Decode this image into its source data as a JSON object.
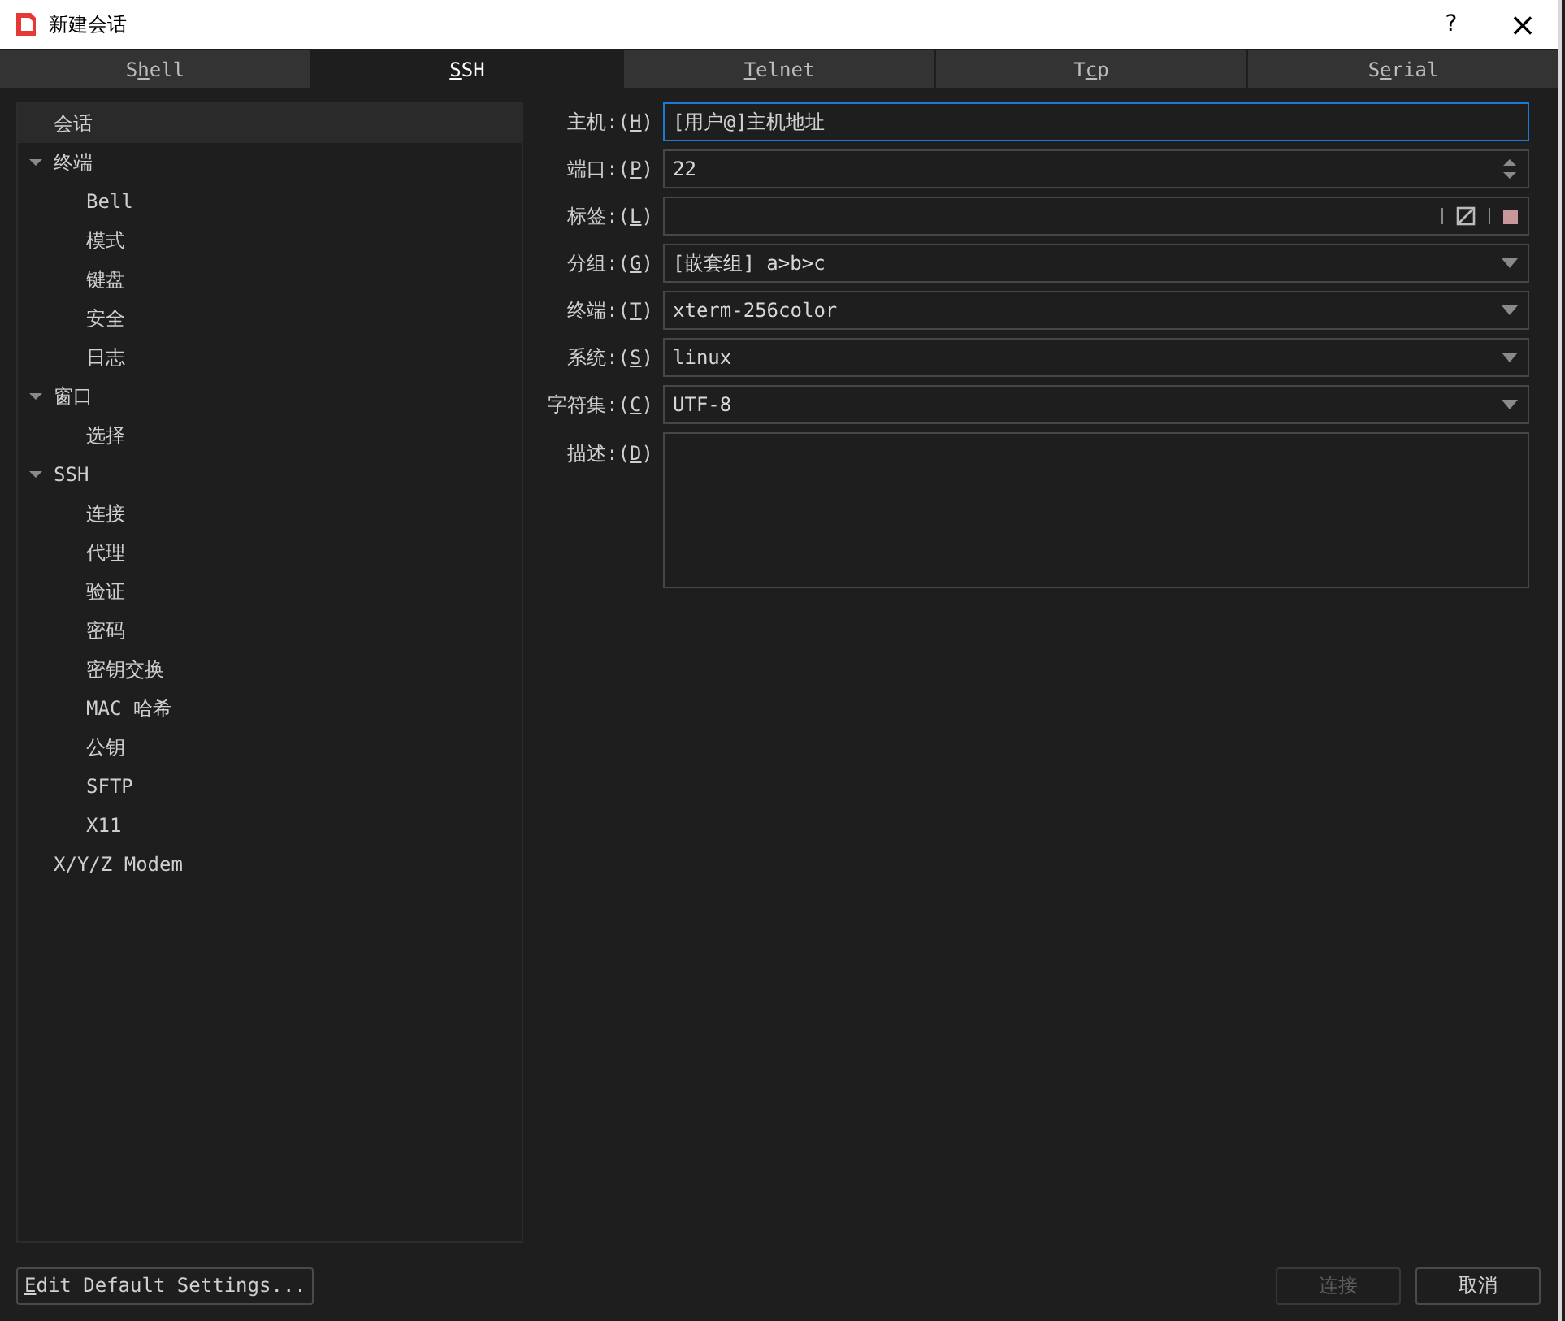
{
  "window": {
    "title": "新建会话",
    "help": "?",
    "close": "×"
  },
  "tabs": [
    {
      "before": "S",
      "key": "h",
      "after": "ell",
      "selected": false
    },
    {
      "key": "S",
      "after": "SH",
      "selected": true
    },
    {
      "key": "T",
      "after": "elnet",
      "selected": false
    },
    {
      "before": "T",
      "key": "c",
      "after": "p",
      "selected": false
    },
    {
      "before": "S",
      "key": "e",
      "after": "rial",
      "selected": false
    }
  ],
  "sidebar": {
    "items": [
      {
        "label": "会话",
        "selected": true
      },
      {
        "label": "终端",
        "selected": false,
        "expanded": true,
        "children": [
          {
            "label": "Bell",
            "selected": false
          },
          {
            "label": "模式",
            "selected": false
          },
          {
            "label": "键盘",
            "selected": false
          },
          {
            "label": "安全",
            "selected": false
          },
          {
            "label": "日志",
            "selected": false
          }
        ]
      },
      {
        "label": "窗口",
        "selected": false,
        "expanded": true,
        "children": [
          {
            "label": "选择",
            "selected": false
          }
        ]
      },
      {
        "label": "SSH",
        "selected": false,
        "expanded": true,
        "children": [
          {
            "label": "连接",
            "selected": false
          },
          {
            "label": "代理",
            "selected": false
          },
          {
            "label": "验证",
            "selected": false
          },
          {
            "label": "密码",
            "selected": false
          },
          {
            "label": "密钥交换",
            "selected": false
          },
          {
            "label": "MAC 哈希",
            "selected": false
          },
          {
            "label": "公钥",
            "selected": false
          },
          {
            "label": "SFTP",
            "selected": false
          },
          {
            "label": "X11",
            "selected": false
          }
        ]
      },
      {
        "label": "X/Y/Z Modem",
        "selected": false
      }
    ]
  },
  "form": [
    {
      "kind": "text",
      "before": "主机:(",
      "key": "H",
      "after": ")",
      "placeholder": "[用户@]主机地址",
      "focused": true
    },
    {
      "kind": "spin",
      "before": "端口:(",
      "key": "P",
      "after": ")",
      "value": "22",
      "focused": false
    },
    {
      "kind": "tag",
      "before": "标签:(",
      "key": "L",
      "after": ")",
      "color": "#c9979a",
      "focused": false
    },
    {
      "kind": "select",
      "before": "分组:(",
      "key": "G",
      "after": ")",
      "value": "[嵌套组] a>b>c",
      "focused": false
    },
    {
      "kind": "select",
      "before": "终端:(",
      "key": "T",
      "after": ")",
      "value": "xterm-256color",
      "focused": false
    },
    {
      "kind": "select",
      "before": "系统:(",
      "key": "S",
      "after": ")",
      "value": "linux",
      "focused": false
    },
    {
      "kind": "select",
      "before": "字符集:(",
      "key": "C",
      "after": ")",
      "value": "UTF-8",
      "focused": false
    },
    {
      "kind": "textarea",
      "before": "描述:(",
      "key": "D",
      "after": ")",
      "focused": false
    }
  ],
  "buttons": {
    "edit_defaults": {
      "key": "E",
      "after": "dit Default Settings..."
    },
    "connect": {
      "label": "连接",
      "disabled": true
    },
    "cancel": {
      "label": "取消",
      "disabled": false
    }
  }
}
